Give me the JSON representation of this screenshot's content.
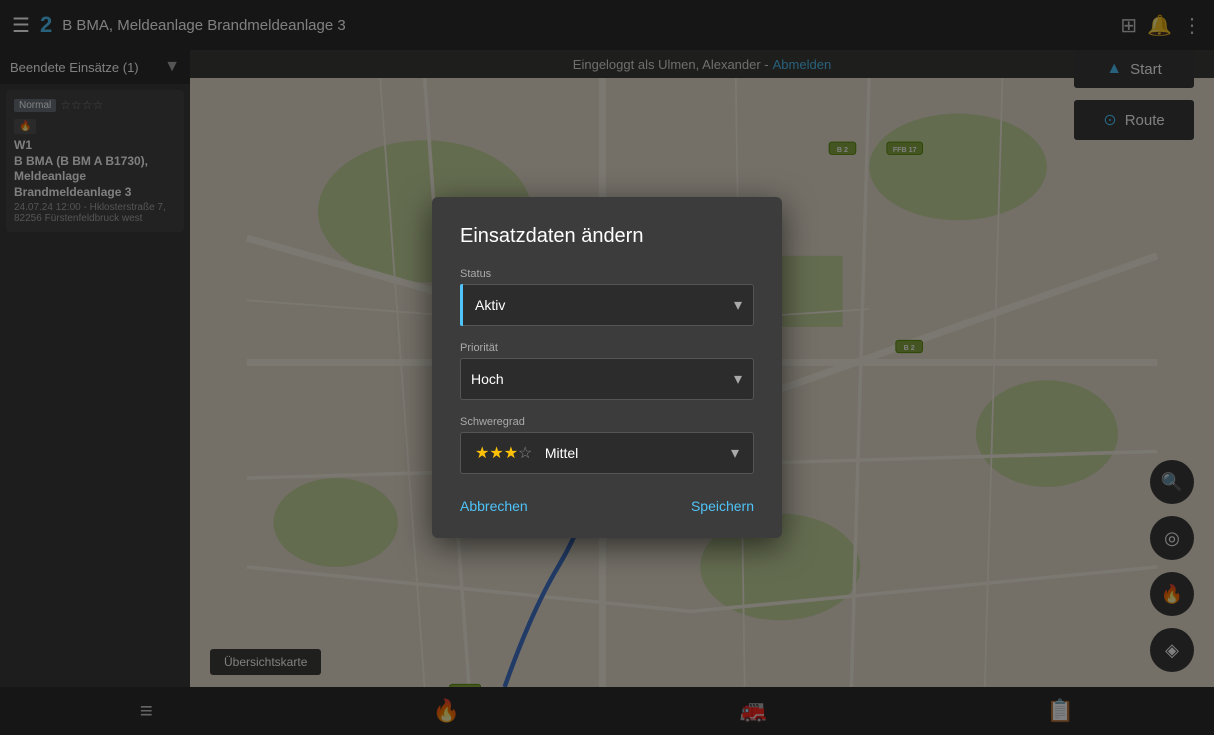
{
  "header": {
    "menu_icon": "☰",
    "incident_number": "2",
    "incident_title": "B BMA, Meldeanlage  Brandmeldeanlage 3",
    "icons": {
      "grid": "⊞",
      "bell": "🔔",
      "more": "⋮"
    }
  },
  "login_bar": {
    "text": "Eingeloggt als Ulmen, Alexander -",
    "logout_link": "Abmelden"
  },
  "sidebar": {
    "header": "Beendete Einsätze (1)",
    "card": {
      "badge": "Normal",
      "stars": "☆☆☆☆",
      "type_badge": "B🔥",
      "line1": "W1",
      "line2": "B BMA (B BM A B1730), Meldeanlage Brandmeldeanlage 3",
      "date": "24.07.24 12:00 - Hklosterstraße 7, 82256 Fürstenfeldbruck west"
    }
  },
  "map_buttons": {
    "start_label": "Start",
    "route_label": "Route"
  },
  "overview_btn": "Übersichtskarte",
  "bottom_nav": {
    "icon1": "≡",
    "icon2": "🔥",
    "icon3": "🚒",
    "icon4": "📋"
  },
  "modal": {
    "title": "Einsatzdaten ändern",
    "status_label": "Status",
    "status_value": "Aktiv",
    "priority_label": "Priorität",
    "priority_value": "Hoch",
    "severity_label": "Schweregrad",
    "severity_value": "Mittel",
    "severity_stars_filled": "★★★",
    "severity_stars_empty": "☆",
    "cancel_label": "Abbrechen",
    "save_label": "Speichern"
  }
}
